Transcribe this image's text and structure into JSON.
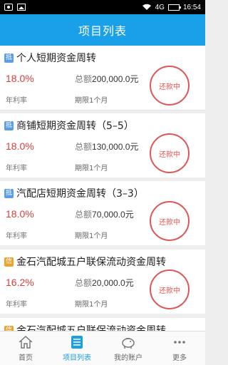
{
  "statusbar": {
    "network": "4G",
    "time": "16:54"
  },
  "header": {
    "title": "项目列表"
  },
  "projects": [
    {
      "badge": "抵",
      "badge_color": "blue",
      "title": "个人短期资金周转",
      "rate": "18.0%",
      "rate_label": "年利率",
      "total_label": "总额",
      "amount": "200,000.0元",
      "period": "期限1个月",
      "status": "还款中"
    },
    {
      "badge": "抵",
      "badge_color": "blue",
      "title": "商铺短期资金周转（5–5）",
      "rate": "18.0%",
      "rate_label": "年利率",
      "total_label": "总额",
      "amount": "130,000.0元",
      "period": "期限1个月",
      "status": "还款中"
    },
    {
      "badge": "抵",
      "badge_color": "blue",
      "title": "汽配店短期资金周转（3–3）",
      "rate": "18.0%",
      "rate_label": "年利率",
      "total_label": "总额",
      "amount": "70,000.0元",
      "period": "期限1个月",
      "status": "还款中"
    },
    {
      "badge": "信",
      "badge_color": "orange",
      "title": "金石汽配城五户联保流动资金周转",
      "rate": "16.2%",
      "rate_label": "年利率",
      "total_label": "总额",
      "amount": "20,000.0元",
      "period": "期限1个月",
      "status": "还款中"
    },
    {
      "badge": "信",
      "badge_color": "orange",
      "title": "金石汽配城五户联保流动资金周转",
      "rate": "",
      "rate_label": "",
      "total_label": "",
      "amount": "",
      "period": "",
      "status": ""
    }
  ],
  "tabs": [
    {
      "label": "首页",
      "icon": "home-icon"
    },
    {
      "label": "项目列表",
      "icon": "list-icon",
      "active": true
    },
    {
      "label": "我的账户",
      "icon": "piggy-bank-icon"
    },
    {
      "label": "更多",
      "icon": "more-icon"
    }
  ],
  "colors": {
    "header": "#1aa0e8",
    "accent_red": "#e05555",
    "rate_red": "#e03b3b"
  }
}
